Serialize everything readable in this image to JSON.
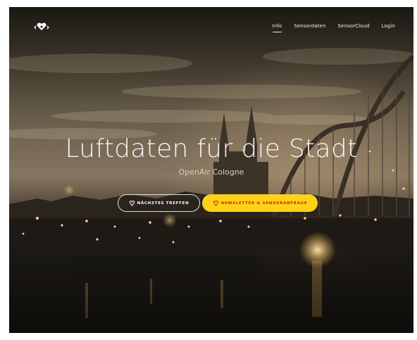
{
  "nav": {
    "logo_icon": "openair-logo-icon",
    "items": [
      {
        "label": "Info",
        "active": true
      },
      {
        "label": "Sensordaten",
        "active": false
      },
      {
        "label": "SensorCloud",
        "active": false
      },
      {
        "label": "Login",
        "active": false
      }
    ]
  },
  "hero": {
    "title": "Luftdaten für die Stadt",
    "subtitle": "OpenAir Cologne",
    "background": "cologne-cathedral-bridge-night-photo"
  },
  "buttons": {
    "meeting": {
      "label": "NÄCHSTES TREFFEN",
      "icon": "heart-shield-icon"
    },
    "newsletter": {
      "label": "NEWSLETTER & SENSORANFRAGE",
      "icon": "heart-shield-icon"
    }
  },
  "colors": {
    "accent_yellow": "#ffd21a",
    "accent_red": "#d5201a",
    "text_light": "#f7f4ef"
  }
}
